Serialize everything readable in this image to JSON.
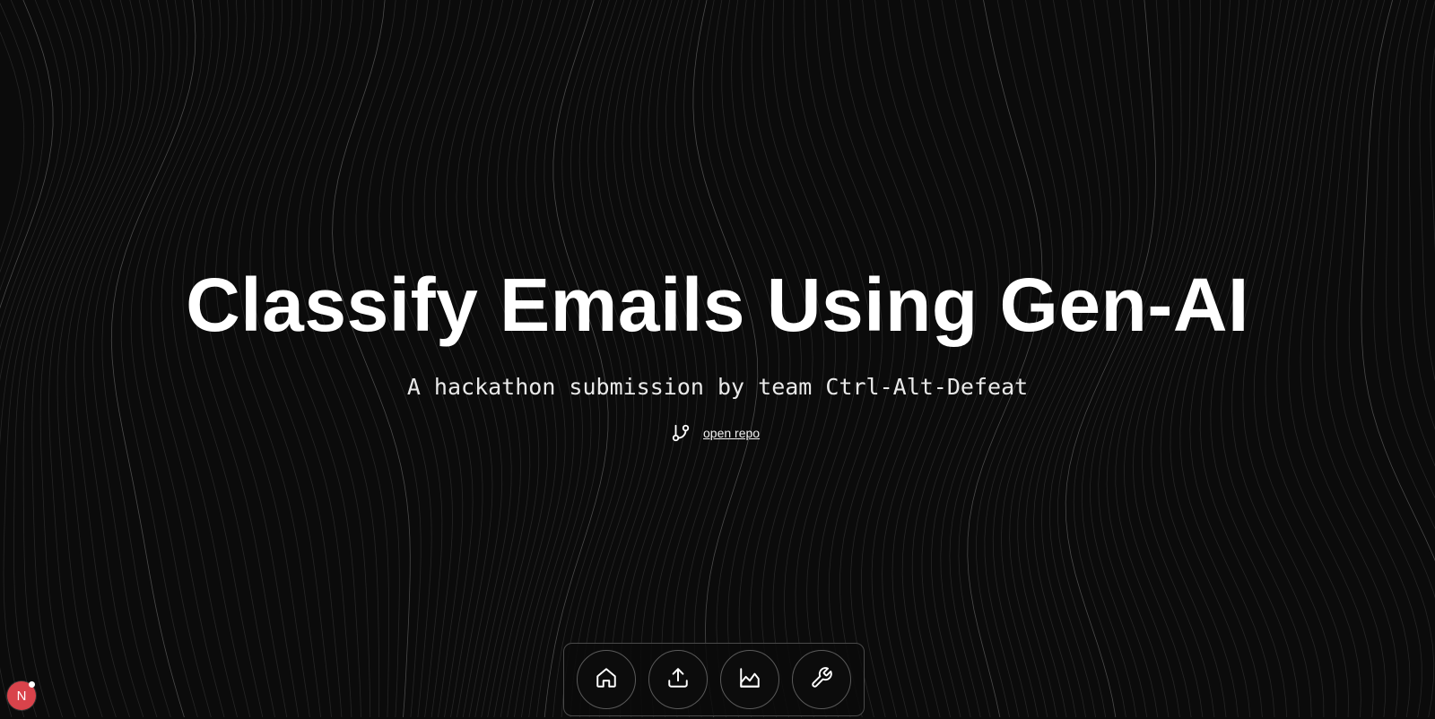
{
  "hero": {
    "title": "Classify Emails Using Gen-AI",
    "subtitle": "A hackathon submission by team Ctrl-Alt-Defeat",
    "repo_link_label": "open repo",
    "repo_icon": "git-branch-icon"
  },
  "dock": {
    "items": [
      {
        "name": "home",
        "icon": "home-icon"
      },
      {
        "name": "upload",
        "icon": "upload-icon"
      },
      {
        "name": "analytics",
        "icon": "chart-icon"
      },
      {
        "name": "tools",
        "icon": "wrench-icon"
      }
    ]
  },
  "dev_indicator": {
    "letter": "N",
    "color": "#d9434b"
  },
  "colors": {
    "background": "#0b0b0b",
    "text": "#ffffff",
    "wave_line": "#2a2a2a"
  }
}
